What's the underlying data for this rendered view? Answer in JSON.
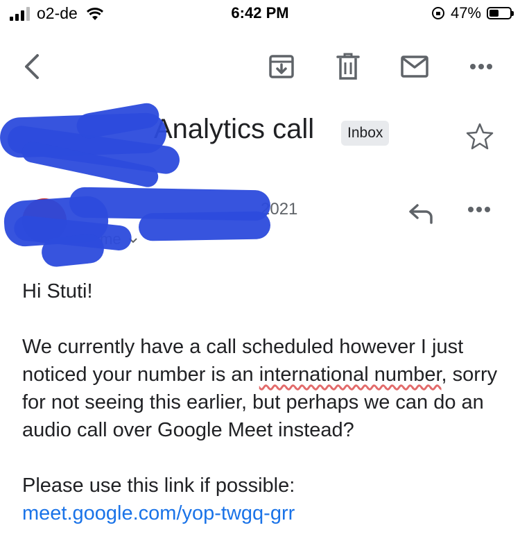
{
  "status_bar": {
    "carrier": "o2-de",
    "time": "6:42 PM",
    "battery_percent": "47%",
    "battery_level": 0.47
  },
  "toolbar": {
    "back_icon": "chevron-left-icon",
    "archive_icon": "archive-icon",
    "delete_icon": "trash-icon",
    "mark_unread_icon": "mail-icon",
    "more_icon": "more-horizontal-icon"
  },
  "email": {
    "subject": "Analytics call",
    "label": "Inbox",
    "date": "2021",
    "recipient": "me",
    "greeting": "Hi Stuti!",
    "paragraph1_a": "We currently have a call scheduled however I just noticed your number is an ",
    "paragraph1_underlined": "international number",
    "paragraph1_b": ", sorry for not seeing this earlier, but perhaps we can do an audio call over Google Meet instead?",
    "paragraph2": "Please use this link if possible:",
    "link": "meet.google.com/yop-twgq-grr"
  },
  "colors": {
    "accent_link": "#1a73e8",
    "redaction": "#2c4bdc",
    "badge_bg": "#e8eaed"
  }
}
